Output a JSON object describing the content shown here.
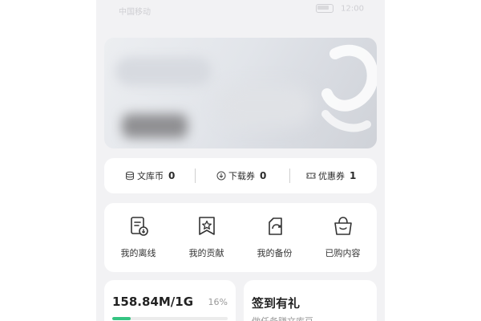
{
  "status_bar": {
    "carrier": "中国移动",
    "time": "12:00"
  },
  "stats_bar": {
    "items": [
      {
        "icon": "coin-stack-icon",
        "label": "文库币",
        "value": "0"
      },
      {
        "icon": "download-ticket-icon",
        "label": "下载券",
        "value": "0"
      },
      {
        "icon": "coupon-icon",
        "label": "优惠券",
        "value": "1"
      }
    ]
  },
  "quick_actions": {
    "items": [
      {
        "icon": "offline-doc-icon",
        "label": "我的离线"
      },
      {
        "icon": "contribution-star-icon",
        "label": "我的贡献"
      },
      {
        "icon": "backup-icon",
        "label": "我的备份"
      },
      {
        "icon": "shopping-bag-icon",
        "label": "已购内容"
      }
    ]
  },
  "storage": {
    "amount": "158.84M/1G",
    "percent_label": "16%",
    "fill_fraction": 0.16,
    "accent": "#35c482"
  },
  "checkin": {
    "title": "签到有礼",
    "subtitle": "做任务赚文库豆"
  }
}
